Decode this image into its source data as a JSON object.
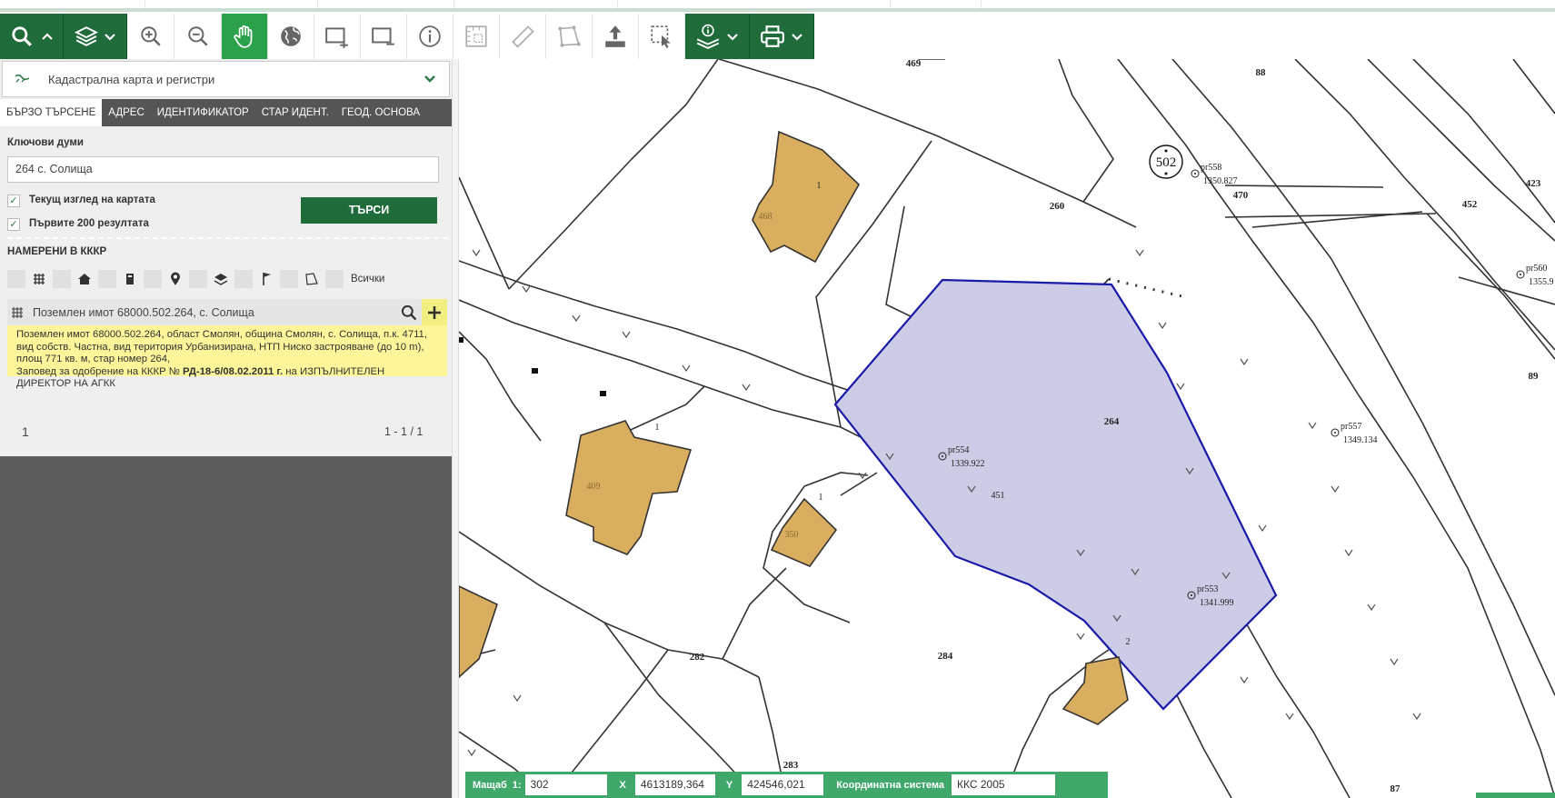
{
  "toolbar": {
    "tools": [
      {
        "name": "search-tool-button",
        "icon": "search-icon"
      },
      {
        "name": "layers-button",
        "icon": "layers-icon"
      },
      {
        "name": "zoom-in-button",
        "icon": "zoom-in-icon"
      },
      {
        "name": "zoom-out-button",
        "icon": "zoom-out-icon"
      },
      {
        "name": "pan-button",
        "icon": "hand-icon"
      },
      {
        "name": "full-extent-button",
        "icon": "globe-icon"
      },
      {
        "name": "zoom-box-in-button",
        "icon": "box-plus-icon"
      },
      {
        "name": "zoom-box-out-button",
        "icon": "box-minus-icon"
      },
      {
        "name": "identify-button",
        "icon": "info-icon"
      },
      {
        "name": "measure-area-button",
        "icon": "measure-area-icon"
      },
      {
        "name": "measure-distance-button",
        "icon": "ruler-icon"
      },
      {
        "name": "draw-polygon-button",
        "icon": "polygon-icon"
      },
      {
        "name": "upload-button",
        "icon": "upload-icon"
      },
      {
        "name": "select-button",
        "icon": "select-icon"
      },
      {
        "name": "layer-info-button",
        "icon": "layer-info-icon"
      },
      {
        "name": "print-button",
        "icon": "print-icon"
      }
    ],
    "active_color": "#2aa14a",
    "brand_color": "#1f6b3a"
  },
  "panel": {
    "layer_select": "Кадастрална карта и регистри",
    "tabs": [
      "БЪРЗО ТЪРСЕНЕ",
      "АДРЕС",
      "ИДЕНТИФИКАТОР",
      "СТАР ИДЕНТ.",
      "ГЕОД. ОСНОВА"
    ],
    "keywords_label": "Ключови думи",
    "keywords_value": "264 с. Солища",
    "check_current_view": "Текущ изглед на картата",
    "check_first_200": "Първите 200 резултата",
    "search_button": "ТЪРСИ",
    "found_label": "НАМЕРЕНИ В КККР",
    "filter_all": "Всички",
    "result_title": "Поземлен имот 68000.502.264, с. Солища",
    "result_line1": "Поземлен имот 68000.502.264, област Смолян, община Смолян, с. Солища, п.к. 4711, вид собств. Частна, вид територия Урбанизирана, НТП Ниско застрояване (до 10 m), площ 771 кв. м, стар номер 264,",
    "result_line2_pre": "Заповед за одобрение на КККР №",
    "result_line2_bold": "РД-18-6/08.02.2011 г.",
    "result_line2_post": "на ИЗПЪЛНИТЕЛЕН ДИРЕКТОР НА АГКК",
    "page_number": "1",
    "page_range": "1 - 1 / 1"
  },
  "map": {
    "parcel_labels": [
      "469",
      "88",
      "423",
      "452",
      "470",
      "260",
      "89",
      "264",
      "282",
      "284",
      "283",
      "87",
      "468",
      "409",
      "350",
      "451",
      "1",
      "1",
      "1",
      "2"
    ],
    "quarter_number": "502",
    "points": [
      {
        "id": "pr558",
        "elev": "1350.827"
      },
      {
        "id": "pr560",
        "elev": "1355.9"
      },
      {
        "id": "pr557",
        "elev": "1349.134"
      },
      {
        "id": "pr554",
        "elev": "1339.922"
      },
      {
        "id": "pr553",
        "elev": "1341.999"
      }
    ],
    "highlight_fill": "#cccce6",
    "highlight_stroke": "#1a1aa8",
    "building_fill": "#d9ae5f"
  },
  "status": {
    "scale_label": "Мащаб",
    "scale_prefix": "1:",
    "scale_value": "302",
    "x_label": "X",
    "x_value": "4613189,364",
    "y_label": "Y",
    "y_value": "424546,021",
    "crs_label": "Координатна система",
    "crs_value": "ККС 2005"
  }
}
